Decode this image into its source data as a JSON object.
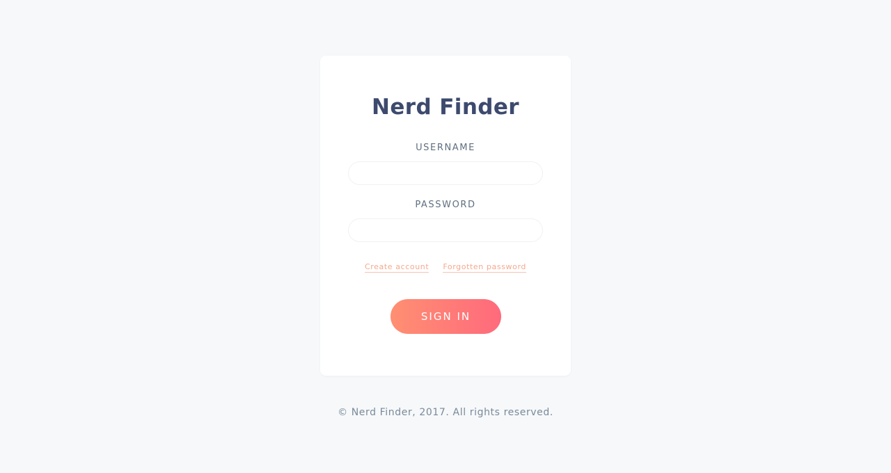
{
  "app": {
    "title": "Nerd Finder"
  },
  "login_form": {
    "username_label": "USERNAME",
    "username_value": "",
    "password_label": "PASSWORD",
    "password_value": "",
    "create_account_link": "Create account",
    "forgot_password_link": "Forgotten password",
    "signin_label": "SIGN IN"
  },
  "footer": {
    "copyright": "© Nerd Finder, 2017. All rights reserved."
  },
  "colors": {
    "background": "#f6f8fa",
    "card": "#ffffff",
    "title": "#3d4a6e",
    "label": "#5e6f80",
    "link": "#f5a98f",
    "button_gradient_start": "#ff8f72",
    "button_gradient_end": "#ff6a7c",
    "footer_text": "#7a8a9a"
  }
}
